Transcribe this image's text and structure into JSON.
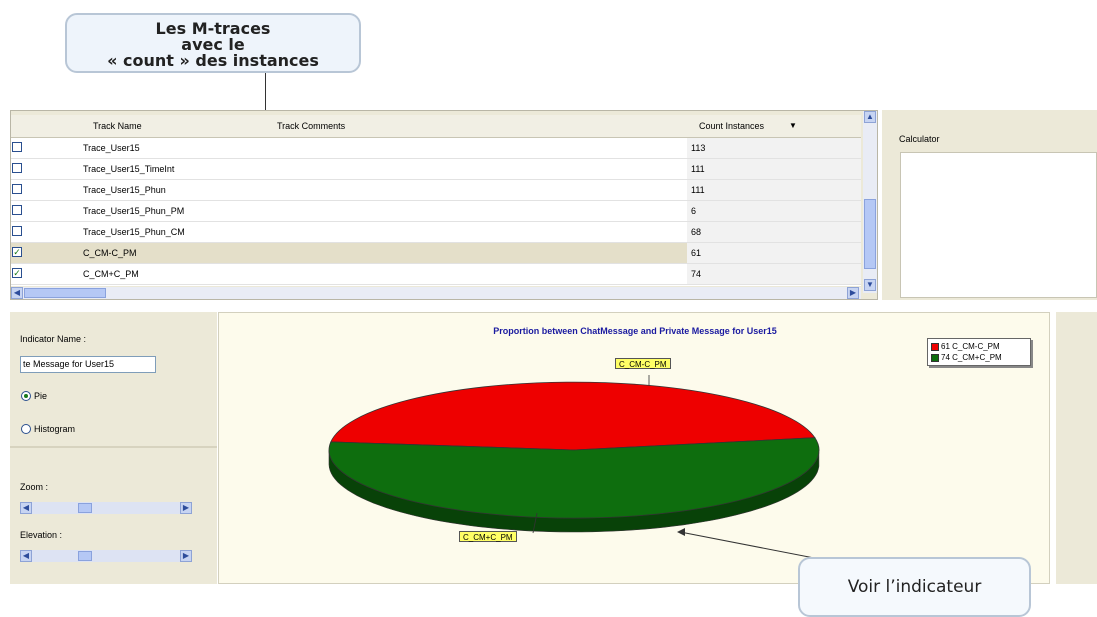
{
  "callouts": {
    "top_line1": "Les M-traces",
    "top_line2": "avec le",
    "top_line3": "« count » des instances",
    "bottom": "Voir l’indicateur"
  },
  "grid": {
    "headers": {
      "name": "Track Name",
      "comments": "Track Comments",
      "count": "Count Instances",
      "sort_icon": "sort-desc-icon"
    },
    "rows": [
      {
        "checked": false,
        "name": "Trace_User15",
        "comments": "",
        "count": "113"
      },
      {
        "checked": false,
        "name": "Trace_User15_TimeInt",
        "comments": "",
        "count": "111"
      },
      {
        "checked": false,
        "name": "Trace_User15_Phun",
        "comments": "",
        "count": "111"
      },
      {
        "checked": false,
        "name": "Trace_User15_Phun_PM",
        "comments": "",
        "count": "6"
      },
      {
        "checked": false,
        "name": "Trace_User15_Phun_CM",
        "comments": "",
        "count": "68"
      },
      {
        "checked": true,
        "name": "C_CM-C_PM",
        "comments": "",
        "count": "61",
        "selected": true
      },
      {
        "checked": true,
        "name": "C_CM+C_PM",
        "comments": "",
        "count": "74"
      }
    ]
  },
  "calculator": {
    "label": "Calculator"
  },
  "controls": {
    "indicator_name_label": "Indicator Name :",
    "indicator_name_value": "te Message for User15",
    "pie_label": "Pie",
    "histogram_label": "Histogram",
    "chart_type_selected": "Pie",
    "zoom_label": "Zoom :",
    "elevation_label": "Elevation :"
  },
  "chart_data": {
    "type": "pie",
    "title": "Proportion between ChatMessage and  Private Message for User15",
    "slices": [
      {
        "label": "C_CM-C_PM",
        "value": 61,
        "color": "#ee0000"
      },
      {
        "label": "C_CM+C_PM",
        "value": 74,
        "color": "#0e6e0e"
      }
    ],
    "legend": [
      "61 C_CM-C_PM",
      "74 C_CM+C_PM"
    ],
    "legend_position": "top-right",
    "style": "3d"
  }
}
